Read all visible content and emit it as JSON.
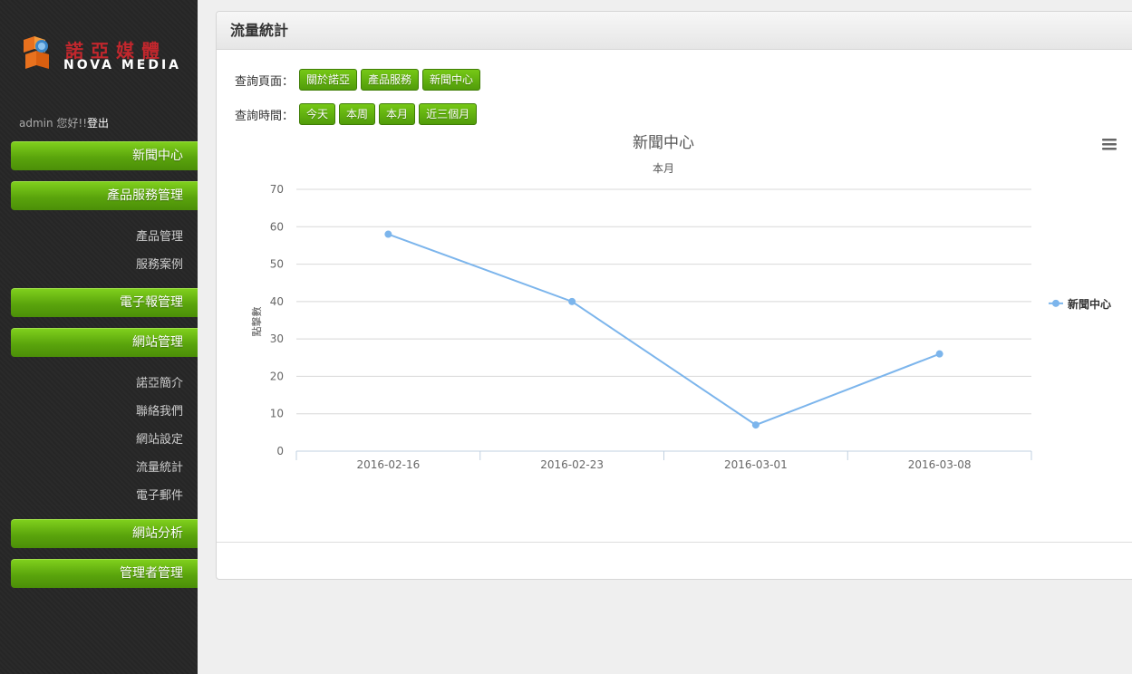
{
  "sidebar": {
    "logo": {
      "cn": "諾亞媒體",
      "en": "NOVA MEDIA"
    },
    "user": {
      "greeting": "admin 您好!!",
      "logout": "登出"
    },
    "menu": [
      {
        "label": "新聞中心"
      },
      {
        "label": "產品服務管理",
        "children": [
          "產品管理",
          "服務案例"
        ]
      },
      {
        "label": "電子報管理"
      },
      {
        "label": "網站管理",
        "children": [
          "諾亞簡介",
          "聯絡我們",
          "網站設定",
          "流量統計",
          "電子郵件"
        ]
      },
      {
        "label": "網站分析"
      },
      {
        "label": "管理者管理"
      }
    ]
  },
  "panel": {
    "title": "流量統計",
    "page_filter": {
      "label": "查詢頁面：",
      "options": [
        "關於諾亞",
        "產品服務",
        "新聞中心"
      ]
    },
    "time_filter": {
      "label": "查詢時間：",
      "options": [
        "今天",
        "本周",
        "本月",
        "近三個月"
      ]
    }
  },
  "chart_data": {
    "type": "line",
    "title": "新聞中心",
    "subtitle": "本月",
    "ylabel": "點擊數",
    "xlabel": "",
    "categories": [
      "2016-02-16",
      "2016-02-23",
      "2016-03-01",
      "2016-03-08"
    ],
    "series": [
      {
        "name": "新聞中心",
        "values": [
          58,
          40,
          7,
          26
        ],
        "color": "#7cb5ec"
      }
    ],
    "ylim": [
      0,
      70
    ],
    "yticks": [
      0,
      10,
      20,
      30,
      40,
      50,
      60,
      70
    ],
    "grid": true,
    "legend": "right"
  }
}
